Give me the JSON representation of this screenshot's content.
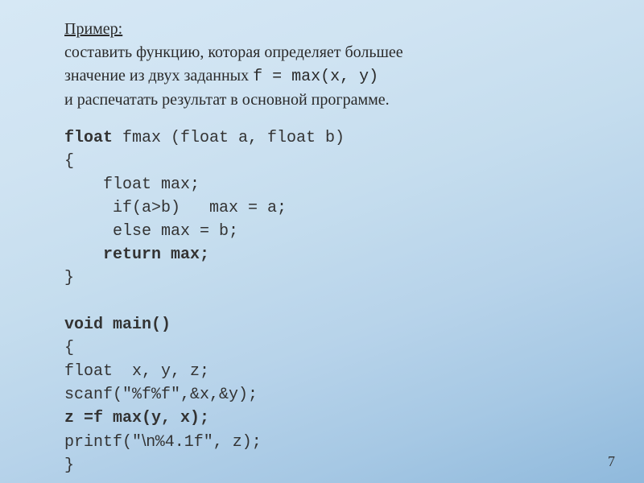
{
  "intro": {
    "title": "Пример:",
    "line1": "составить функцию, которая определяет большее",
    "line2_a": "значение из двух заданных ",
    "line2_code": "f  = max(x, y)",
    "line3": "и распечатать результат в основной программе."
  },
  "code": {
    "l1_kw": "float",
    "l1_rest": " fmax (float a, float b)",
    "l2": "{",
    "l3": "    float max;",
    "l4": "     if(a>b)   max = a;",
    "l5": "     else max = b;",
    "l6_pre": "    ",
    "l6_kw": "return max;",
    "l7": "}",
    "l8": "",
    "l9": "void main()",
    "l10": "{",
    "l11": "float  x, y, z;",
    "l12": "scanf(\"%f%f\",&x,&y);",
    "l13": "z =f max(y, x);",
    "l14_a": "printf(\"",
    "l14_b": "\\n",
    "l14_c": "%4.1f\", z);",
    "l15": "}"
  },
  "page_number": "7"
}
